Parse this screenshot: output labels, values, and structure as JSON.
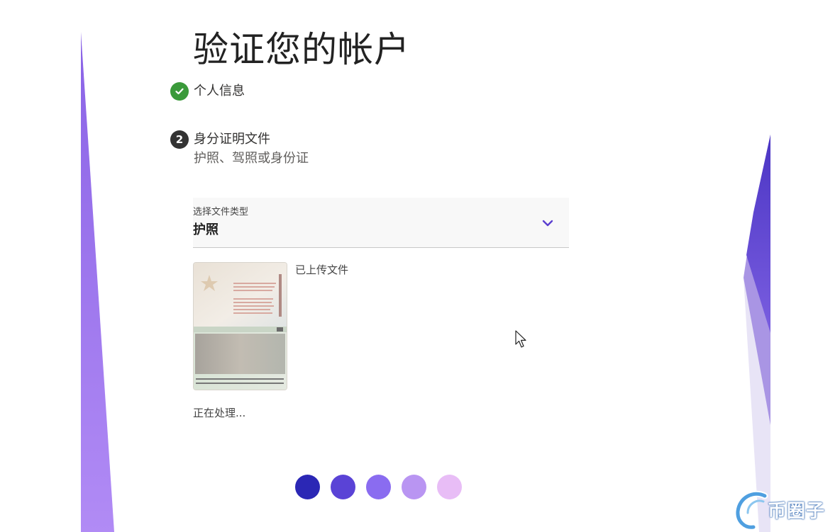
{
  "page": {
    "title": "验证您的帐户"
  },
  "steps": [
    {
      "label": "个人信息",
      "status": "complete",
      "icon": "check-icon"
    },
    {
      "number": "2",
      "label": "身分证明文件",
      "sublabel": "护照、驾照或身份证",
      "status": "current"
    }
  ],
  "document_select": {
    "label": "选择文件类型",
    "value": "护照",
    "icon": "chevron-down-icon"
  },
  "upload": {
    "status": "已上传文件",
    "processing": "正在处理..."
  },
  "progress_dots": [
    "#2b27b5",
    "#5a43d6",
    "#8a6cf0",
    "#b995f2",
    "#e8bdf6"
  ],
  "watermark": {
    "text": "币圈子"
  },
  "colors": {
    "accent": "#5b3fd0",
    "success": "#3a9a3a",
    "decor_purple": "#8a63e6"
  }
}
